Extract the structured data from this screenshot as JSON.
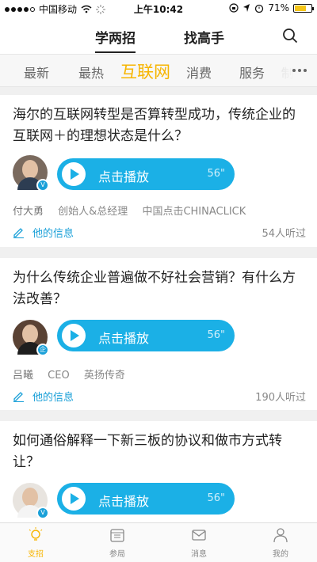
{
  "status_bar": {
    "carrier": "中国移动",
    "time": "上午10:42",
    "battery": "71%",
    "battery_level": 0.71
  },
  "top_tabs": [
    {
      "label": "学两招",
      "active": true
    },
    {
      "label": "找高手",
      "active": false
    }
  ],
  "categories": [
    {
      "label": "最新"
    },
    {
      "label": "最热"
    },
    {
      "label": "互联网",
      "active": true
    },
    {
      "label": "消费"
    },
    {
      "label": "服务"
    },
    {
      "label": "制"
    }
  ],
  "feed": [
    {
      "question": "海尔的互联网转型是否算转型成功，传统企业的互联网＋的理想状态是什么？",
      "play_label": "点击播放",
      "duration": "56\"",
      "author": "付大勇",
      "title": "创始人&总经理",
      "company": "中国点击CHINACLICK",
      "info_label": "他的信息",
      "listeners": "54人听过"
    },
    {
      "question": "为什么传统企业普遍做不好社会营销？有什么方法改善？",
      "play_label": "点击播放",
      "duration": "56\"",
      "author": "吕曦",
      "title": "CEO",
      "company": "英扬传奇",
      "info_label": "他的信息",
      "listeners": "190人听过"
    },
    {
      "question": "如何通俗解释一下新三板的协议和做市方式转让？",
      "play_label": "点击播放",
      "duration": "56\""
    }
  ],
  "bottom_nav": [
    {
      "label": "支招",
      "icon": "bulb-icon",
      "active": true
    },
    {
      "label": "参局",
      "icon": "calendar-icon"
    },
    {
      "label": "消息",
      "icon": "mail-icon"
    },
    {
      "label": "我的",
      "icon": "person-icon"
    }
  ],
  "colors": {
    "accent": "#f7b500",
    "player": "#1bb0e6",
    "link": "#1aa0d8"
  }
}
